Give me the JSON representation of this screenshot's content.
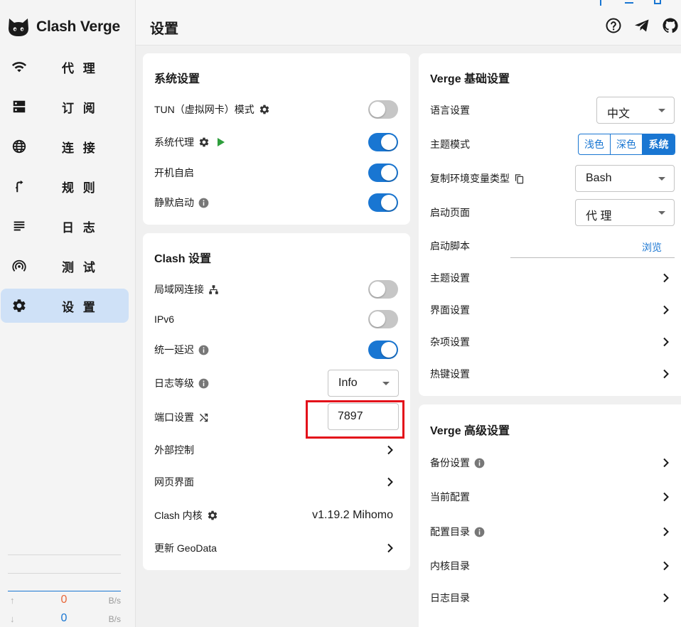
{
  "app": {
    "name": "Clash Verge"
  },
  "sidebar": {
    "items": [
      {
        "label": "代 理",
        "icon": "wifi-icon"
      },
      {
        "label": "订 阅",
        "icon": "dns-icon"
      },
      {
        "label": "连 接",
        "icon": "globe-icon"
      },
      {
        "label": "规 则",
        "icon": "fork-icon"
      },
      {
        "label": "日 志",
        "icon": "list-icon"
      },
      {
        "label": "测 试",
        "icon": "radar-icon"
      },
      {
        "label": "设 置",
        "icon": "gear-icon"
      }
    ],
    "active_index": 6,
    "traffic": {
      "upload": {
        "value": "0",
        "unit": "B/s",
        "color": "#e8673a"
      },
      "download": {
        "value": "0",
        "unit": "B/s",
        "color": "#1976d2"
      }
    }
  },
  "header": {
    "title": "设置",
    "icons": [
      "help-icon",
      "telegram-icon",
      "github-icon"
    ]
  },
  "system_settings": {
    "title": "系统设置",
    "rows": [
      {
        "label": "TUN（虚拟网卡）模式",
        "toggle": false
      },
      {
        "label": "系统代理",
        "toggle": true
      },
      {
        "label": "开机自启",
        "toggle": true
      },
      {
        "label": "静默启动",
        "toggle": true
      }
    ]
  },
  "clash_settings": {
    "title": "Clash 设置",
    "lan": {
      "label": "局域网连接",
      "toggle": false
    },
    "ipv6": {
      "label": "IPv6",
      "toggle": false
    },
    "unified_delay": {
      "label": "统一延迟",
      "toggle": true
    },
    "log_level": {
      "label": "日志等级",
      "value": "Info"
    },
    "port": {
      "label": "端口设置",
      "value": "7897"
    },
    "external_control": {
      "label": "外部控制"
    },
    "web_ui": {
      "label": "网页界面"
    },
    "core": {
      "label": "Clash 内核",
      "value": "v1.19.2 Mihomo"
    },
    "geodata": {
      "label": "更新 GeoData"
    }
  },
  "verge_basic": {
    "title": "Verge 基础设置",
    "language": {
      "label": "语言设置",
      "value": "中文"
    },
    "theme_mode": {
      "label": "主题模式",
      "options": [
        "浅色",
        "深色",
        "系统"
      ],
      "selected": 2
    },
    "env_type": {
      "label": "复制环境变量类型",
      "value": "Bash"
    },
    "start_page": {
      "label": "启动页面",
      "value": "代 理"
    },
    "start_script": {
      "label": "启动脚本",
      "browse": "浏览"
    },
    "theme_settings": {
      "label": "主题设置"
    },
    "ui_settings": {
      "label": "界面设置"
    },
    "misc_settings": {
      "label": "杂项设置"
    },
    "hotkey_settings": {
      "label": "热键设置"
    }
  },
  "verge_advanced": {
    "title": "Verge 高级设置",
    "rows": [
      {
        "label": "备份设置"
      },
      {
        "label": "当前配置"
      },
      {
        "label": "配置目录"
      },
      {
        "label": "内核目录"
      },
      {
        "label": "日志目录"
      }
    ]
  },
  "colors": {
    "accent": "#1976d2",
    "highlight": "#e3101a",
    "toggle_off": "#c6c6c6"
  }
}
